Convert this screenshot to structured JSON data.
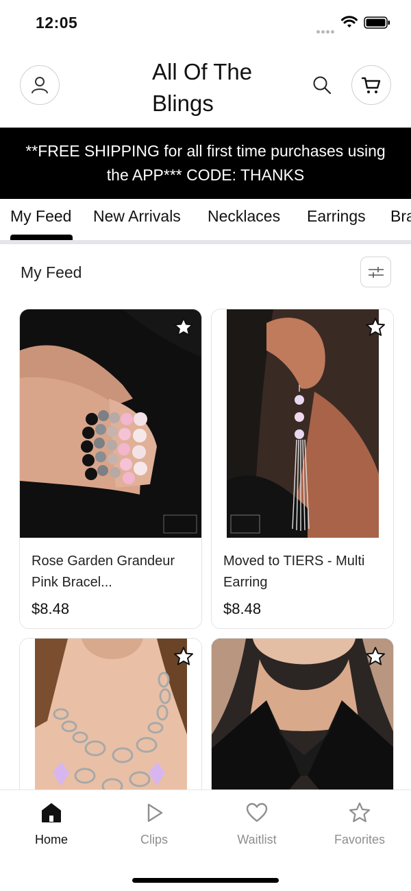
{
  "status_bar": {
    "time": "12:05"
  },
  "header": {
    "title": "All Of The Blings"
  },
  "banner": {
    "text": "**FREE SHIPPING for all first time purchases using the APP*** CODE: THANKS"
  },
  "tabs": [
    "My Feed",
    "New Arrivals",
    "Necklaces",
    "Earrings",
    "Bracelets"
  ],
  "active_tab": "My Feed",
  "section": {
    "title": "My Feed"
  },
  "products": [
    {
      "name": "Rose Garden Grandeur Pink Bracel...",
      "price": "$8.48"
    },
    {
      "name": "Moved to TIERS - Multi Earring",
      "price": "$8.48"
    },
    {
      "name": "",
      "price": ""
    },
    {
      "name": "",
      "price": ""
    }
  ],
  "bottom_nav": [
    {
      "label": "Home",
      "icon": "home-icon",
      "active": true
    },
    {
      "label": "Clips",
      "icon": "play-icon",
      "active": false
    },
    {
      "label": "Waitlist",
      "icon": "heart-icon",
      "active": false
    },
    {
      "label": "Favorites",
      "icon": "star-icon",
      "active": false
    }
  ],
  "colors": {
    "banner_bg": "#000000",
    "text": "#111111",
    "inactive_nav": "#8e8e8e",
    "divider": "#e3e5e8"
  }
}
